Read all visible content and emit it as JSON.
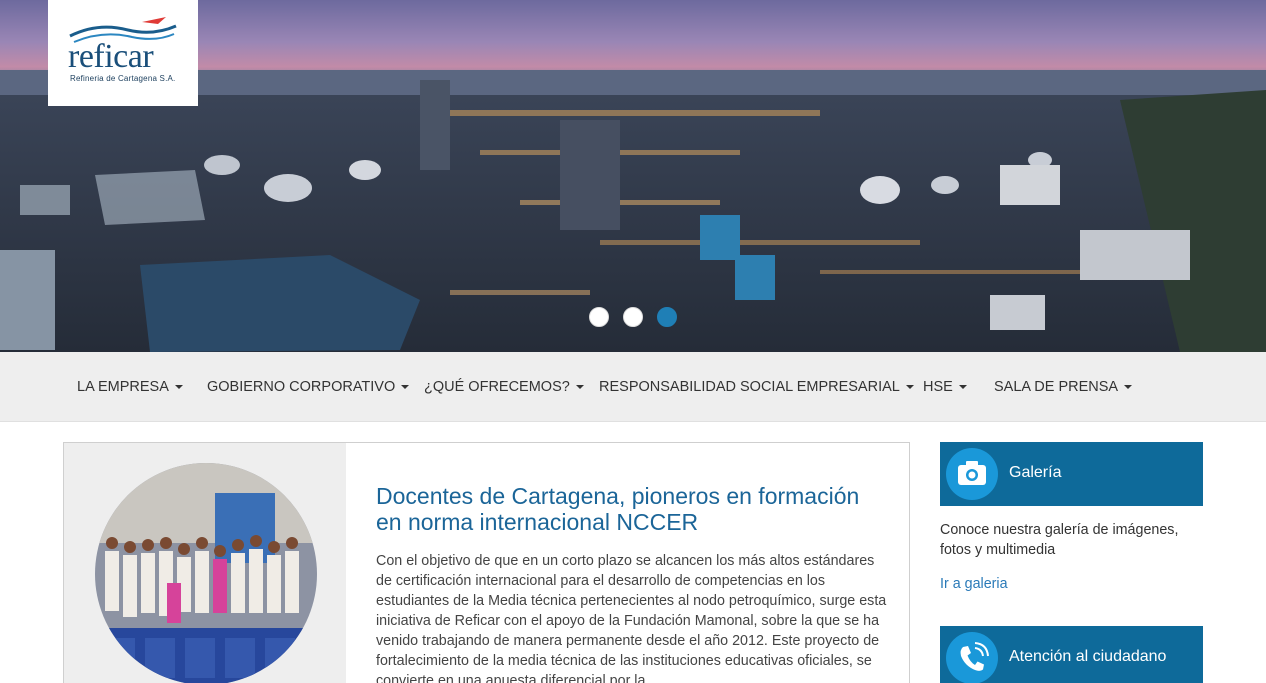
{
  "brand": {
    "name": "reficar",
    "tagline": "Refineria de Cartagena S.A."
  },
  "carousel": {
    "slide_count": 3,
    "active_index": 2
  },
  "nav": {
    "items": [
      {
        "label": "LA EMPRESA"
      },
      {
        "label": "GOBIERNO CORPORATIVO"
      },
      {
        "label": "¿QUÉ OFRECEMOS?"
      },
      {
        "label": "RESPONSABILIDAD SOCIAL EMPRESARIAL"
      },
      {
        "label": "HSE"
      },
      {
        "label": "SALA DE PRENSA"
      }
    ]
  },
  "news": {
    "title": "Docentes de Cartagena, pioneros en formación en norma internacional NCCER",
    "body": "Con el objetivo de que en un corto plazo se alcancen los más altos estándares de certificación internacional para el desarrollo de competencias en los estudiantes de la Media técnica pertenecientes al nodo petroquímico, surge esta iniciativa de Reficar con el apoyo de la Fundación Mamonal, sobre la que se ha venido trabajando de manera permanente desde el año 2012. Este proyecto de fortalecimiento de la media técnica de las instituciones educativas oficiales, se convierte en una apuesta diferencial por la"
  },
  "sidebar": {
    "gallery": {
      "title": "Galería",
      "icon": "camera-icon",
      "description": "Conoce nuestra galería de imágenes, fotos y multimedia",
      "link": "Ir a galeria"
    },
    "citizen": {
      "title": "Atención al ciudadano",
      "icon": "phone-icon"
    }
  },
  "colors": {
    "brand_blue": "#0e6a9a",
    "icon_blue": "#1a98d9",
    "title_blue": "#1b6598",
    "link_blue": "#2a7ab8",
    "nav_bg": "#eeeeee"
  }
}
